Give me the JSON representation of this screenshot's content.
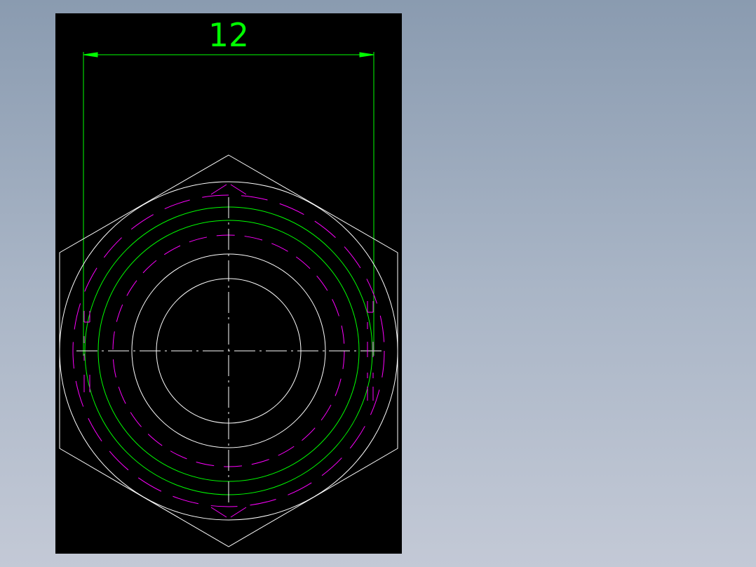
{
  "workspace": {
    "background": "model-space",
    "viewport_color": "#000000"
  },
  "drawing": {
    "dimension_text": "12",
    "dimension_color": "#00ff00",
    "geometry_color": "#ffffff",
    "hidden_line_color": "#ff00ff",
    "thread_circle_color": "#00ff00",
    "centerline_color": "#ffffff"
  }
}
